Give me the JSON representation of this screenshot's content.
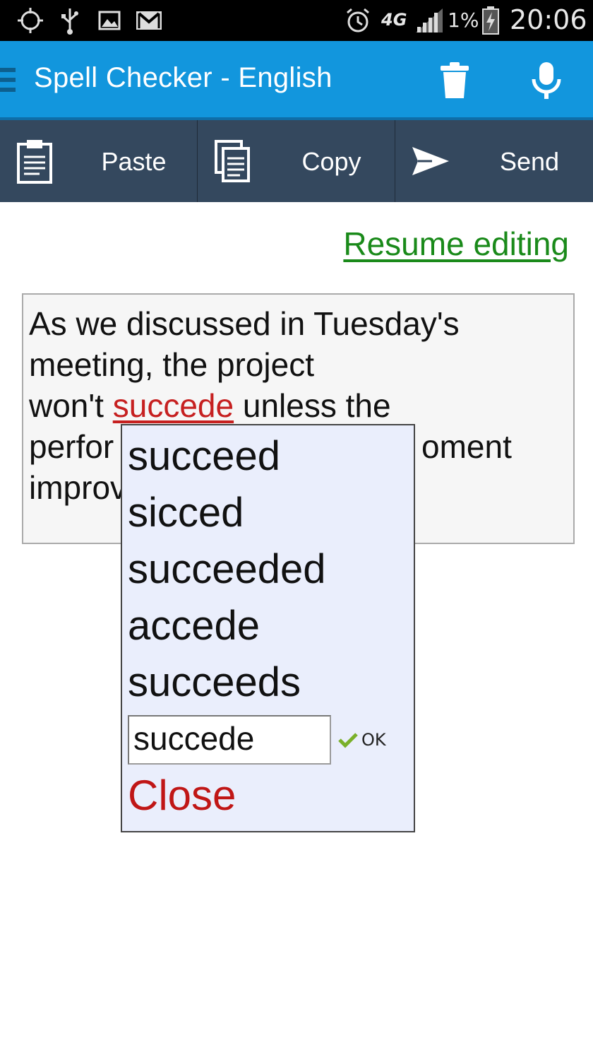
{
  "status_bar": {
    "battery_percent": "1%",
    "network_type": "4G",
    "time": "20:06",
    "icons": [
      "location-icon",
      "usb-icon",
      "image-icon",
      "gmail-icon",
      "alarm-icon",
      "network-4g-icon",
      "signal-icon",
      "battery-charging-icon"
    ]
  },
  "app_bar": {
    "title": "Spell Checker - English",
    "actions": [
      "delete-icon",
      "microphone-icon"
    ],
    "color": "#1296dd"
  },
  "toolbar": {
    "paste_label": "Paste",
    "copy_label": "Copy",
    "send_label": "Send",
    "color": "#34485e"
  },
  "resume_link": "Resume editing",
  "document": {
    "line1": "As we discussed in Tuesday's",
    "line2": "meeting, the project",
    "line3_before": "won't ",
    "misspelled_word": "succede",
    "line3_after": " unless the",
    "line4_visible_start": "perfor",
    "line4_visible_end": "oment",
    "line5_visible_start": "improv"
  },
  "suggestion_popup": {
    "suggestions": [
      "succeed",
      "sicced",
      "succeeded",
      "accede",
      "succeeds"
    ],
    "edit_value": "succede",
    "ok_label": "OK",
    "close_label": "Close",
    "background": "#eaeefc"
  }
}
